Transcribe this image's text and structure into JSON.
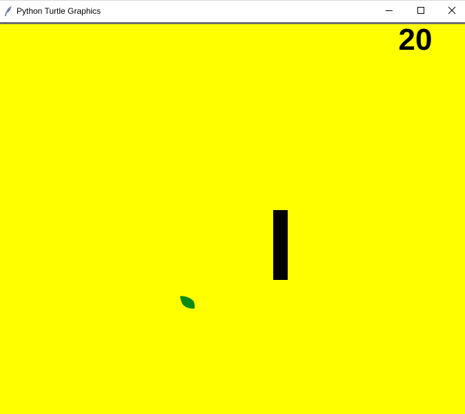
{
  "window": {
    "title": "Python Turtle Graphics",
    "icon": "feather-icon",
    "controls": {
      "minimize_icon": "minimize-icon",
      "maximize_icon": "maximize-icon",
      "close_icon": "close-icon"
    }
  },
  "game": {
    "score": "20",
    "background_color": "#ffff00",
    "snake_color": "#000000",
    "food_color": "#0a8a14"
  }
}
